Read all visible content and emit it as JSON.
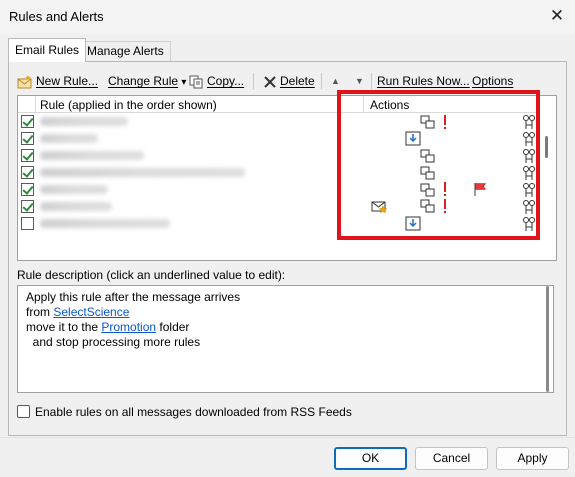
{
  "window": {
    "title": "Rules and Alerts",
    "close_glyph": "✕"
  },
  "tabs": [
    {
      "label": "Email Rules",
      "active": true
    },
    {
      "label": "Manage Alerts",
      "active": false
    }
  ],
  "toolbar": {
    "new_rule": "New Rule...",
    "change_rule": "Change Rule",
    "change_rule_arrow": "▾",
    "copy": "Copy...",
    "delete": "Delete",
    "move_up": "▲",
    "move_down": "▼",
    "run_rules": "Run Rules Now...",
    "options": "Options"
  },
  "rules_table": {
    "columns": [
      "Rule (applied in the order shown)",
      "Actions"
    ],
    "rows": [
      {
        "enabled": true,
        "actions": [
          "copy-to-folder-icon",
          "importance-icon",
          "stop-processing-icon"
        ]
      },
      {
        "enabled": true,
        "actions": [
          "move-to-folder-icon",
          "stop-processing-icon"
        ]
      },
      {
        "enabled": true,
        "actions": [
          "copy-to-folder-icon",
          "stop-processing-icon"
        ]
      },
      {
        "enabled": true,
        "actions": [
          "copy-to-folder-icon",
          "stop-processing-icon"
        ]
      },
      {
        "enabled": true,
        "actions": [
          "copy-to-folder-icon",
          "importance-icon",
          "flag-icon",
          "stop-processing-icon"
        ]
      },
      {
        "enabled": true,
        "actions": [
          "new-item-alert-icon",
          "copy-to-folder-icon",
          "importance-icon",
          "stop-processing-icon"
        ]
      },
      {
        "enabled": false,
        "actions": [
          "move-to-folder-icon",
          "stop-processing-icon"
        ]
      }
    ]
  },
  "description": {
    "label": "Rule description (click an underlined value to edit):",
    "line1": "Apply this rule after the message arrives",
    "line2_prefix": "from ",
    "line2_link": "SelectScience",
    "line3_prefix": "move it to the ",
    "line3_link": "Promotion",
    "line3_suffix": " folder",
    "line4": "  and stop processing more rules"
  },
  "rss_option": {
    "label": "Enable rules on all messages downloaded from RSS Feeds",
    "checked": false
  },
  "buttons": {
    "ok": "OK",
    "cancel": "Cancel",
    "apply": "Apply"
  },
  "colors": {
    "highlight": "#e0151c",
    "link": "#0b57d0",
    "check": "#2d8a3b",
    "importance": "#d81f26",
    "flag": "#e23b3b",
    "move_arrow": "#1f6fc9"
  }
}
